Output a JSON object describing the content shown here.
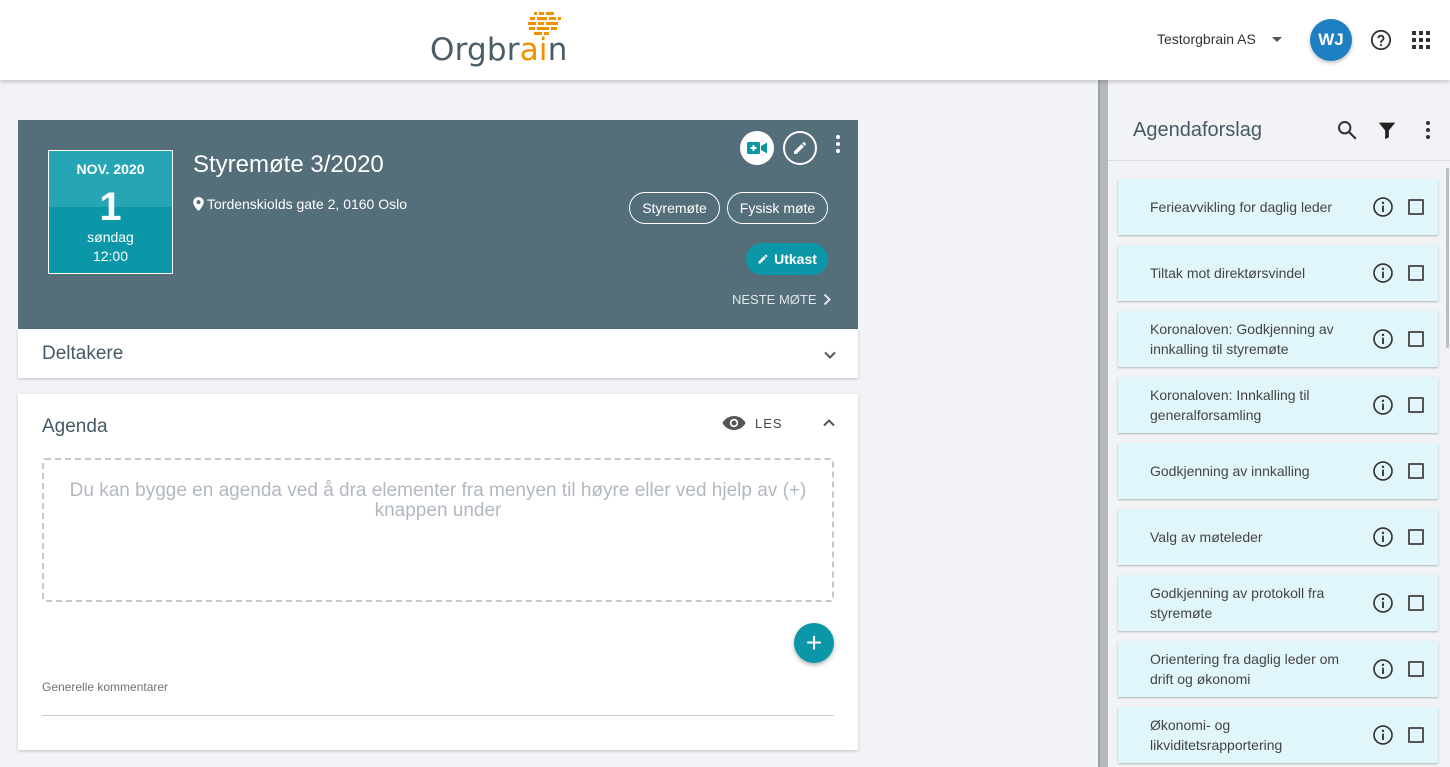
{
  "brand": {
    "name_prefix": "Orgbr",
    "name_accent": "ai",
    "name_suffix": "n",
    "accent_color": "#f29100",
    "text_color": "#4b5d68"
  },
  "header": {
    "organization": "Testorgbrain AS",
    "avatar_initials": "WJ",
    "avatar_color": "#1e7fc3",
    "icons": [
      "help-icon",
      "apps-grid-icon"
    ]
  },
  "meeting": {
    "date": {
      "month": "NOV. 2020",
      "day": "1",
      "weekday": "søndag",
      "time": "12:00"
    },
    "title": "Styremøte 3/2020",
    "location": "Tordenskiolds gate 2, 0160 Oslo",
    "tags": [
      "Styremøte",
      "Fysisk møte"
    ],
    "status": "Utkast",
    "next_meeting": "NESTE MØTE",
    "card_color": "#546e7a",
    "accent_color": "#0b97a7"
  },
  "participants": {
    "title": "Deltakere"
  },
  "agenda": {
    "title": "Agenda",
    "mode_label": "LES",
    "empty_text": "Du kan bygge en agenda ved å dra elementer fra menyen til høyre eller ved hjelp av (+) knappen under",
    "add_label": "+",
    "comments_label": "Generelle kommentarer"
  },
  "sidebar": {
    "title": "Agendaforslag",
    "items": [
      {
        "label": "Ferieavvikling for daglig leder"
      },
      {
        "label": "Tiltak mot direktørsvindel"
      },
      {
        "label": "Koronaloven: Godkjenning av innkalling til styremøte"
      },
      {
        "label": "Koronaloven: Innkalling til generalforsamling"
      },
      {
        "label": "Godkjenning av innkalling"
      },
      {
        "label": "Valg av møteleder"
      },
      {
        "label": "Godkjenning av protokoll fra styremøte"
      },
      {
        "label": "Orientering fra daglig leder om drift og økonomi"
      },
      {
        "label": "Økonomi- og likviditetsrapportering"
      }
    ]
  }
}
